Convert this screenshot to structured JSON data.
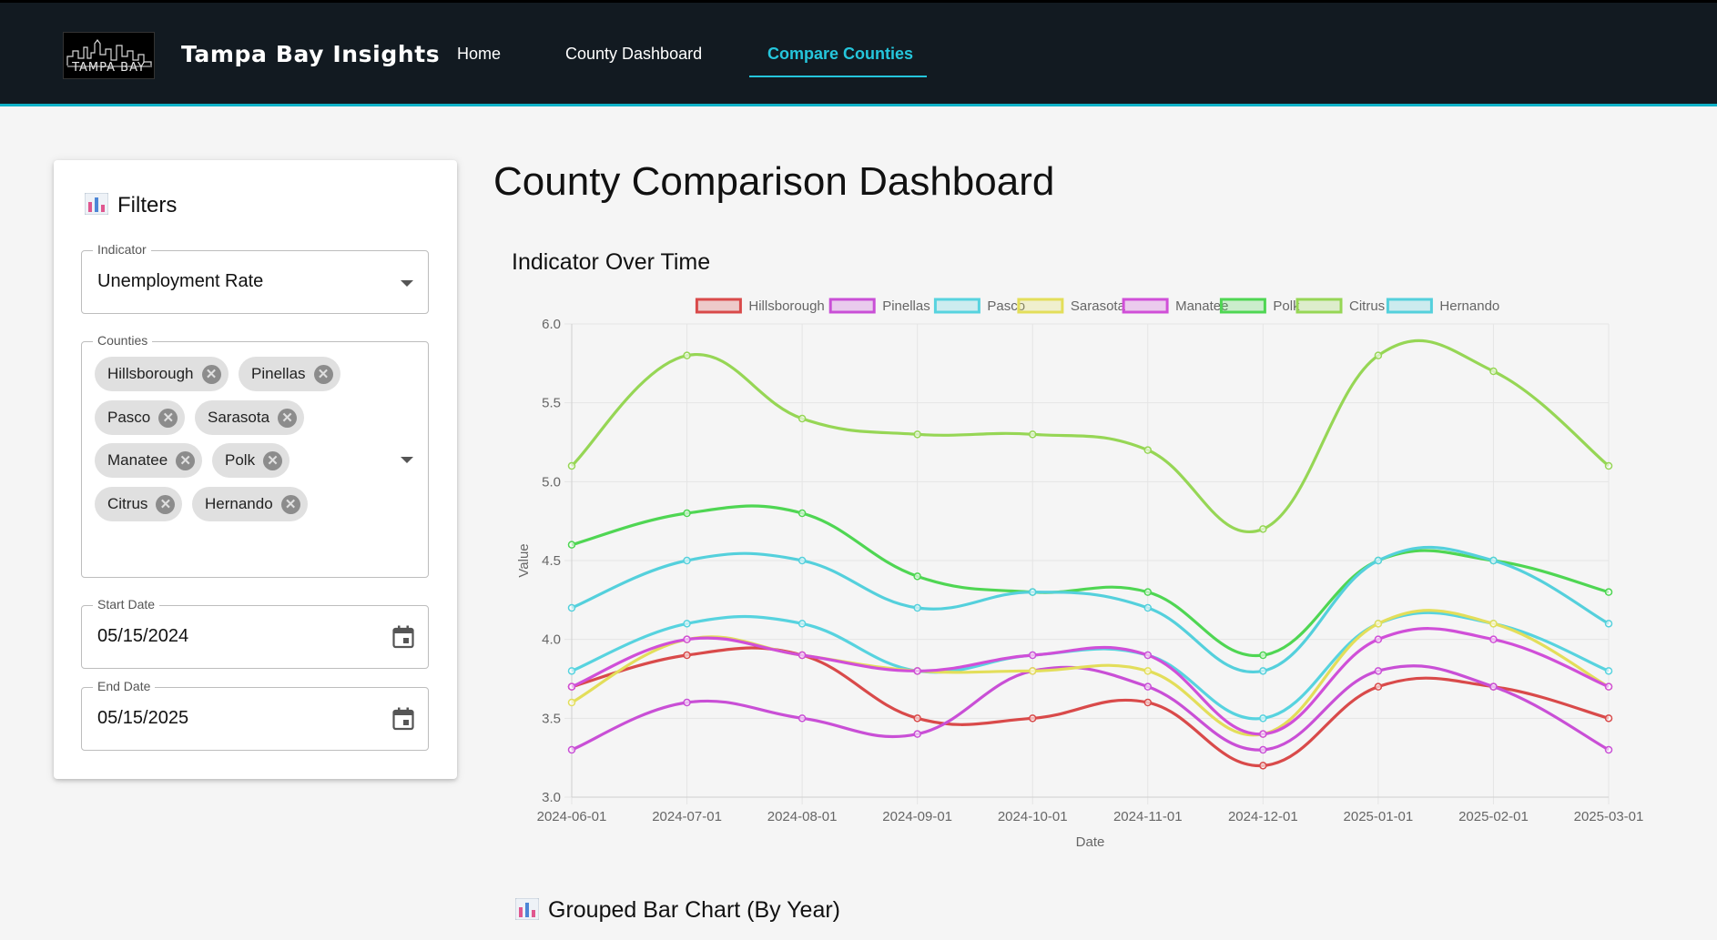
{
  "brand": "Tampa Bay Insights",
  "logo_text": "TAMPA BAY",
  "nav": [
    {
      "label": "Home",
      "active": false
    },
    {
      "label": "County Dashboard",
      "active": false
    },
    {
      "label": "Compare Counties",
      "active": true
    }
  ],
  "filters": {
    "title": "Filters",
    "title_icon": "bar-chart-icon",
    "indicator": {
      "label": "Indicator",
      "value": "Unemployment Rate"
    },
    "counties": {
      "label": "Counties",
      "selected": [
        "Hillsborough",
        "Pinellas",
        "Pasco",
        "Sarasota",
        "Manatee",
        "Polk",
        "Citrus",
        "Hernando"
      ]
    },
    "start_date": {
      "label": "Start Date",
      "value": "05/15/2024"
    },
    "end_date": {
      "label": "End Date",
      "value": "05/15/2025"
    }
  },
  "page_title": "County Comparison Dashboard",
  "line_chart_title": "Indicator Over Time",
  "bar_chart_title": "Grouped Bar Chart (By Year)",
  "chart_data": {
    "type": "line",
    "xlabel": "Date",
    "ylabel": "Value",
    "ylim": [
      3.0,
      6.0
    ],
    "yticks": [
      "3.0",
      "3.5",
      "4.0",
      "4.5",
      "5.0",
      "5.5",
      "6.0"
    ],
    "x": [
      "2024-06-01",
      "2024-07-01",
      "2024-08-01",
      "2024-09-01",
      "2024-10-01",
      "2024-11-01",
      "2024-12-01",
      "2025-01-01",
      "2025-02-01",
      "2025-03-01"
    ],
    "grid": true,
    "legend_position": "top",
    "series": [
      {
        "name": "Hillsborough",
        "color": "#d94a4a",
        "values": [
          3.7,
          3.9,
          3.9,
          3.5,
          3.5,
          3.6,
          3.2,
          3.7,
          3.7,
          3.5
        ]
      },
      {
        "name": "Pinellas",
        "color": "#c94fd6",
        "values": [
          3.3,
          3.6,
          3.5,
          3.4,
          3.8,
          3.7,
          3.3,
          3.8,
          3.7,
          3.3
        ]
      },
      {
        "name": "Pasco",
        "color": "#57d3df",
        "values": [
          3.8,
          4.1,
          4.1,
          3.8,
          3.9,
          3.9,
          3.5,
          4.1,
          4.1,
          3.8
        ]
      },
      {
        "name": "Sarasota",
        "color": "#e3de5a",
        "values": [
          3.6,
          4.0,
          3.9,
          3.8,
          3.8,
          3.8,
          3.4,
          4.1,
          4.1,
          3.7
        ]
      },
      {
        "name": "Manatee",
        "color": "#d04fd8",
        "values": [
          3.7,
          4.0,
          3.9,
          3.8,
          3.9,
          3.9,
          3.4,
          4.0,
          4.0,
          3.7
        ]
      },
      {
        "name": "Polk",
        "color": "#4fd653",
        "values": [
          4.6,
          4.8,
          4.8,
          4.4,
          4.3,
          4.3,
          3.9,
          4.5,
          4.5,
          4.3
        ]
      },
      {
        "name": "Citrus",
        "color": "#96d655",
        "values": [
          5.1,
          5.8,
          5.4,
          5.3,
          5.3,
          5.2,
          4.7,
          5.8,
          5.7,
          5.1
        ]
      },
      {
        "name": "Hernando",
        "color": "#54d0dc",
        "values": [
          4.2,
          4.5,
          4.5,
          4.2,
          4.3,
          4.2,
          3.8,
          4.5,
          4.5,
          4.1
        ]
      }
    ]
  }
}
